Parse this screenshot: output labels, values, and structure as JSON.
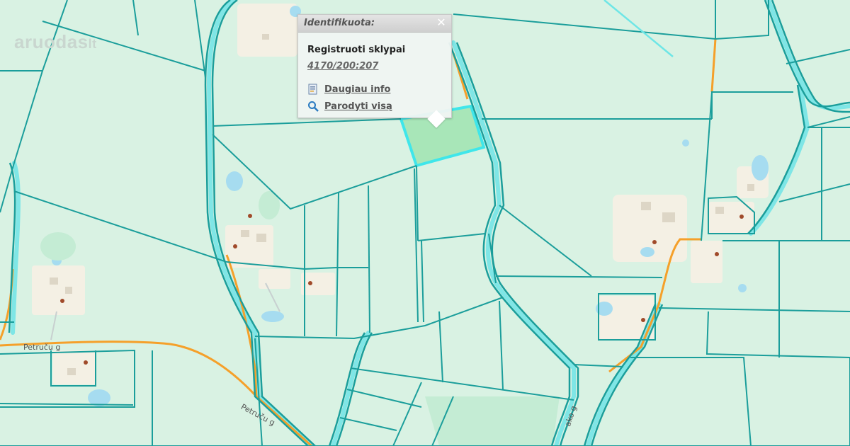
{
  "map": {
    "watermark": "aruodas",
    "watermark_suffix": "lt",
    "street_labels": {
      "petrucu_1": "Petruču g",
      "petrucu_2": "Petruču g",
      "cut_label": "ako g"
    },
    "colors": {
      "background": "#d9f2e3",
      "parcel_border": "#1b9e9b",
      "road_casing": "#6ee6e6",
      "road_orange": "#f5a02a",
      "selected_fill": "#a8e6b8",
      "selected_border": "#3fe6ea",
      "water": "#a6dcf0",
      "building_area": "#f4f0e4",
      "house_marker": "#a04a2a"
    }
  },
  "popup": {
    "title": "Identifikuota:",
    "close_icon": "close-icon",
    "heading": "Registruoti sklypai",
    "parcel_id": "4170/200:207",
    "links": [
      {
        "label": "Daugiau info",
        "icon": "info-document-icon"
      },
      {
        "label": "Parodyti visą",
        "icon": "magnifier-icon"
      }
    ]
  }
}
